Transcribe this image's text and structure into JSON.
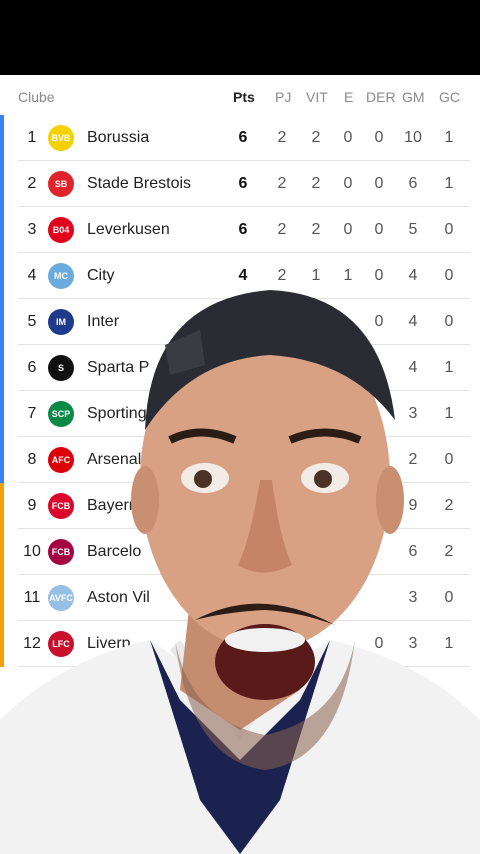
{
  "header": {
    "club": "Clube",
    "pts": "Pts",
    "pj": "PJ",
    "vit": "VIT",
    "e": "E",
    "der": "DER",
    "gm": "GM",
    "gc": "GC"
  },
  "colors": {
    "qualify": "#3b82f6",
    "playoff": "#f59e0b"
  },
  "rows": [
    {
      "pos": "1",
      "name": "Borussia",
      "pts": "6",
      "pj": "2",
      "vit": "2",
      "e": "0",
      "der": "0",
      "gm": "10",
      "gc": "1",
      "crest": "BVB",
      "crest_color": "#f5d100"
    },
    {
      "pos": "2",
      "name": "Stade Brestois",
      "pts": "6",
      "pj": "2",
      "vit": "2",
      "e": "0",
      "der": "0",
      "gm": "6",
      "gc": "1",
      "crest": "SB",
      "crest_color": "#e0242b"
    },
    {
      "pos": "3",
      "name": "Leverkusen",
      "pts": "6",
      "pj": "2",
      "vit": "2",
      "e": "0",
      "der": "0",
      "gm": "5",
      "gc": "0",
      "crest": "B04",
      "crest_color": "#e2001a"
    },
    {
      "pos": "4",
      "name": "City",
      "pts": "4",
      "pj": "2",
      "vit": "1",
      "e": "1",
      "der": "0",
      "gm": "4",
      "gc": "0",
      "crest": "MC",
      "crest_color": "#6cabdd"
    },
    {
      "pos": "5",
      "name": "Inter",
      "pts": "",
      "pj": "",
      "vit": "",
      "e": "",
      "der": "0",
      "gm": "4",
      "gc": "0",
      "crest": "IM",
      "crest_color": "#1e3a8a"
    },
    {
      "pos": "6",
      "name": "Sparta P",
      "pts": "",
      "pj": "",
      "vit": "",
      "e": "",
      "der": "",
      "gm": "4",
      "gc": "1",
      "crest": "S",
      "crest_color": "#111111"
    },
    {
      "pos": "7",
      "name": "Sporting",
      "pts": "",
      "pj": "",
      "vit": "",
      "e": "",
      "der": "",
      "gm": "3",
      "gc": "1",
      "crest": "SCP",
      "crest_color": "#0a8a46"
    },
    {
      "pos": "8",
      "name": "Arsenal",
      "pts": "",
      "pj": "",
      "vit": "",
      "e": "",
      "der": "",
      "gm": "2",
      "gc": "0",
      "crest": "AFC",
      "crest_color": "#db0007"
    },
    {
      "pos": "9",
      "name": "Bayern",
      "pts": "",
      "pj": "",
      "vit": "",
      "e": "",
      "der": "",
      "gm": "9",
      "gc": "2",
      "crest": "FCB",
      "crest_color": "#dc052d"
    },
    {
      "pos": "10",
      "name": "Barcelo",
      "pts": "",
      "pj": "",
      "vit": "",
      "e": "",
      "der": "",
      "gm": "6",
      "gc": "2",
      "crest": "FCB",
      "crest_color": "#a50044"
    },
    {
      "pos": "11",
      "name": "Aston Vil",
      "pts": "",
      "pj": "",
      "vit": "",
      "e": "",
      "der": "",
      "gm": "3",
      "gc": "0",
      "crest": "AVFC",
      "crest_color": "#95bfe5"
    },
    {
      "pos": "12",
      "name": "Liverp",
      "pts": "",
      "pj": "",
      "vit": "",
      "e": "",
      "der": "0",
      "gm": "3",
      "gc": "1",
      "crest": "LFC",
      "crest_color": "#c8102e"
    }
  ]
}
